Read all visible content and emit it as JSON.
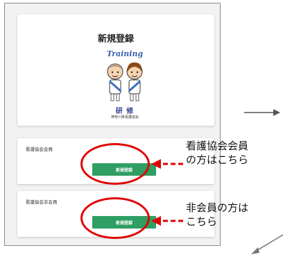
{
  "header": {
    "title": "新規登録",
    "logo_script": "Training",
    "logo_subtitle": "研 修",
    "logo_org": "神奈川県看護協会"
  },
  "member_section": {
    "label": "看護協会会員",
    "button_label": "新規登録"
  },
  "nonmember_section": {
    "label": "看護協会非会員",
    "button_label": "新規登録"
  },
  "annotations": {
    "member_line1": "看護協会会員",
    "member_line2": "の方はこちら",
    "nonmember_line1": "非会員の方は",
    "nonmember_line2": "こちら"
  },
  "colors": {
    "button": "#2f9e63",
    "highlight": "#e00000"
  },
  "icons": [
    "arrow-right-icon",
    "arrow-diagonal-icon"
  ]
}
